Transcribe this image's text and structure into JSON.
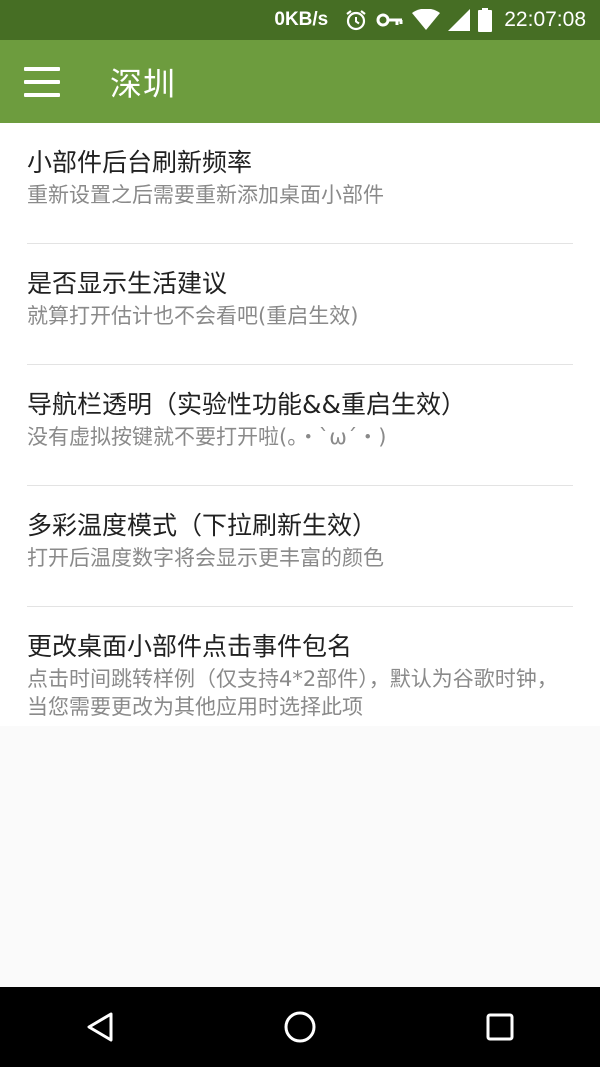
{
  "status_bar": {
    "network_speed": "0KB/s",
    "time": "22:07:08",
    "icons": [
      "alarm-icon",
      "vpn-key-icon",
      "wifi-icon",
      "signal-icon",
      "battery-icon"
    ]
  },
  "app_bar": {
    "title": "深圳",
    "menu_icon": "hamburger-menu-icon"
  },
  "settings": [
    {
      "title": "小部件后台刷新频率",
      "subtitle": "重新设置之后需要重新添加桌面小部件"
    },
    {
      "title": "是否显示生活建议",
      "subtitle": "就算打开估计也不会看吧(重启生效)"
    },
    {
      "title": "导航栏透明（实验性功能&&重启生效）",
      "subtitle": "没有虚拟按键就不要打开啦(。・`ω´・)"
    },
    {
      "title": "多彩温度模式（下拉刷新生效）",
      "subtitle": "打开后温度数字将会显示更丰富的颜色"
    },
    {
      "title": "更改桌面小部件点击事件包名",
      "subtitle": "点击时间跳转样例（仅支持4*2部件），默认为谷歌时钟，当您需要更改为其他应用时选择此项"
    }
  ],
  "nav_bar": {
    "icons": [
      "back-icon",
      "home-icon",
      "recents-icon"
    ]
  },
  "colors": {
    "status_bar": "#466e24",
    "app_bar": "#6d9c3e",
    "title_text": "#212121",
    "subtitle_text": "#8a8a8a"
  }
}
